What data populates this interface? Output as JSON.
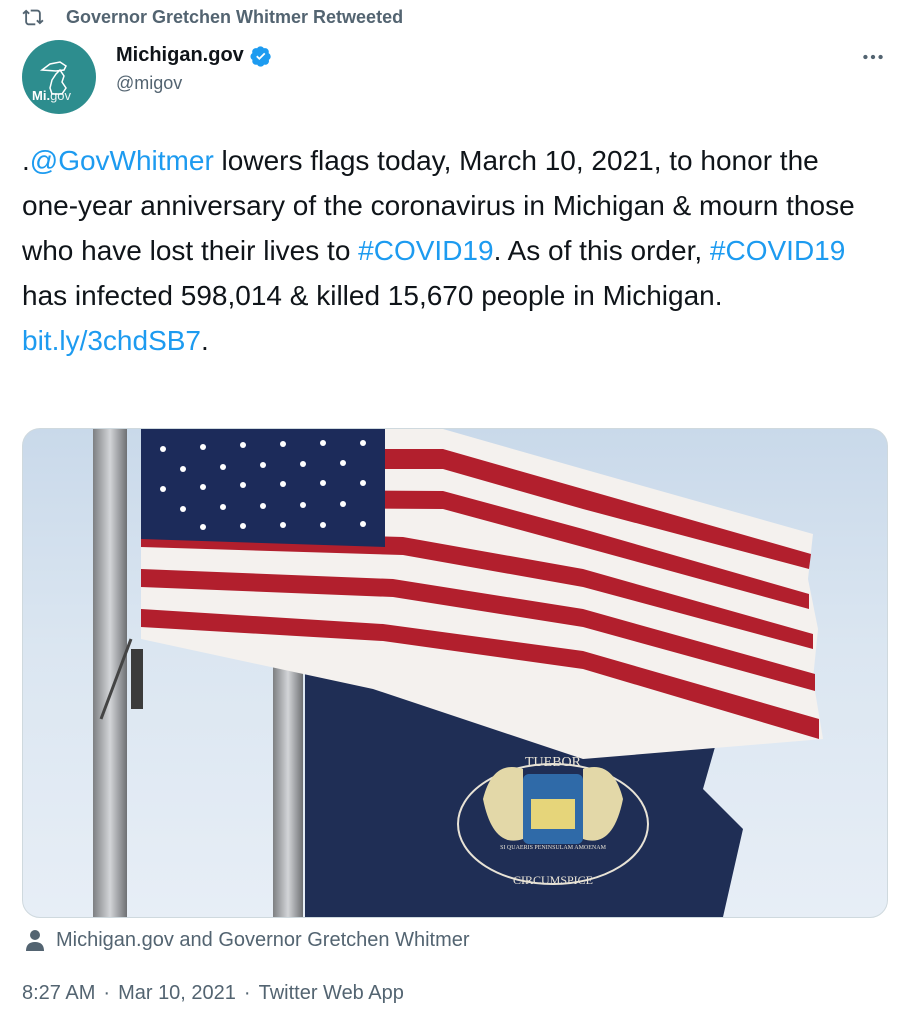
{
  "retweet": {
    "label": "Governor Gretchen Whitmer Retweeted"
  },
  "author": {
    "display_name": "Michigan.gov",
    "handle": "@migov",
    "verified": true,
    "avatar_text_bold": "Mi.",
    "avatar_text_light": "gov",
    "avatar_color": "#2d8d8e"
  },
  "tweet": {
    "segments": [
      {
        "text": ".",
        "type": "text"
      },
      {
        "text": "@GovWhitmer",
        "type": "link"
      },
      {
        "text": " lowers flags today, March 10, 2021, to honor the one-year anniversary of the coronavirus in Michigan & mourn those who have lost their lives to ",
        "type": "text"
      },
      {
        "text": "#COVID19",
        "type": "link"
      },
      {
        "text": ". As of this order, ",
        "type": "text"
      },
      {
        "text": "#COVID19",
        "type": "link"
      },
      {
        "text": " has infected 598,014 & killed 15,670 people in Michigan. ",
        "type": "text"
      },
      {
        "text": "bit.ly/3chdSB7",
        "type": "link"
      },
      {
        "text": ".",
        "type": "text"
      }
    ]
  },
  "media": {
    "seal_motto_top": "TUEBOR",
    "seal_motto_bottom": "CIRCUMSPICE",
    "seal_ribbon": "SI QUAERIS PENINSULAM AMOENAM"
  },
  "tagged": {
    "label": "Michigan.gov and Governor Gretchen Whitmer"
  },
  "meta": {
    "time": "8:27 AM",
    "date": "Mar 10, 2021",
    "source": "Twitter Web App",
    "separator": "·"
  },
  "colors": {
    "link": "#1d9bf0",
    "secondary_text": "#536471",
    "verified": "#1d9bf0"
  }
}
